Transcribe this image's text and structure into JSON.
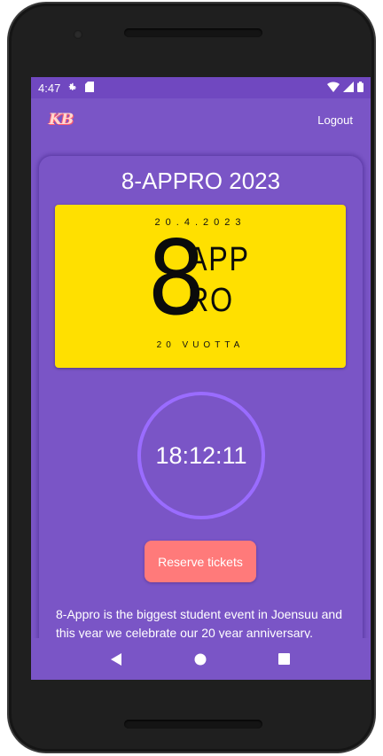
{
  "status_bar": {
    "time": "4:47",
    "icons": [
      "gear-icon",
      "sd-card-icon",
      "wifi-icon",
      "signal-icon",
      "battery-icon"
    ]
  },
  "app_bar": {
    "logo_text": "KB",
    "logout_label": "Logout"
  },
  "event": {
    "title": "8-APPRO 2023",
    "poster": {
      "date": "20.4.2023",
      "big_numeral": "8",
      "line1": "APP",
      "line2": "RO",
      "subtitle": "20 VUOTTA"
    },
    "countdown": "18:12:11",
    "reserve_label": "Reserve tickets",
    "description": "8-Appro is the biggest student event in Joensuu and this year we celebrate our 20 year anniversary."
  },
  "nav_bar": {
    "icons": [
      "back-icon",
      "home-icon",
      "recents-icon"
    ]
  },
  "colors": {
    "primary": "#7a55c6",
    "status": "#7048c0",
    "accent_ring": "#9a6cff",
    "button": "#ff7a7a",
    "poster_bg": "#ffe000"
  }
}
